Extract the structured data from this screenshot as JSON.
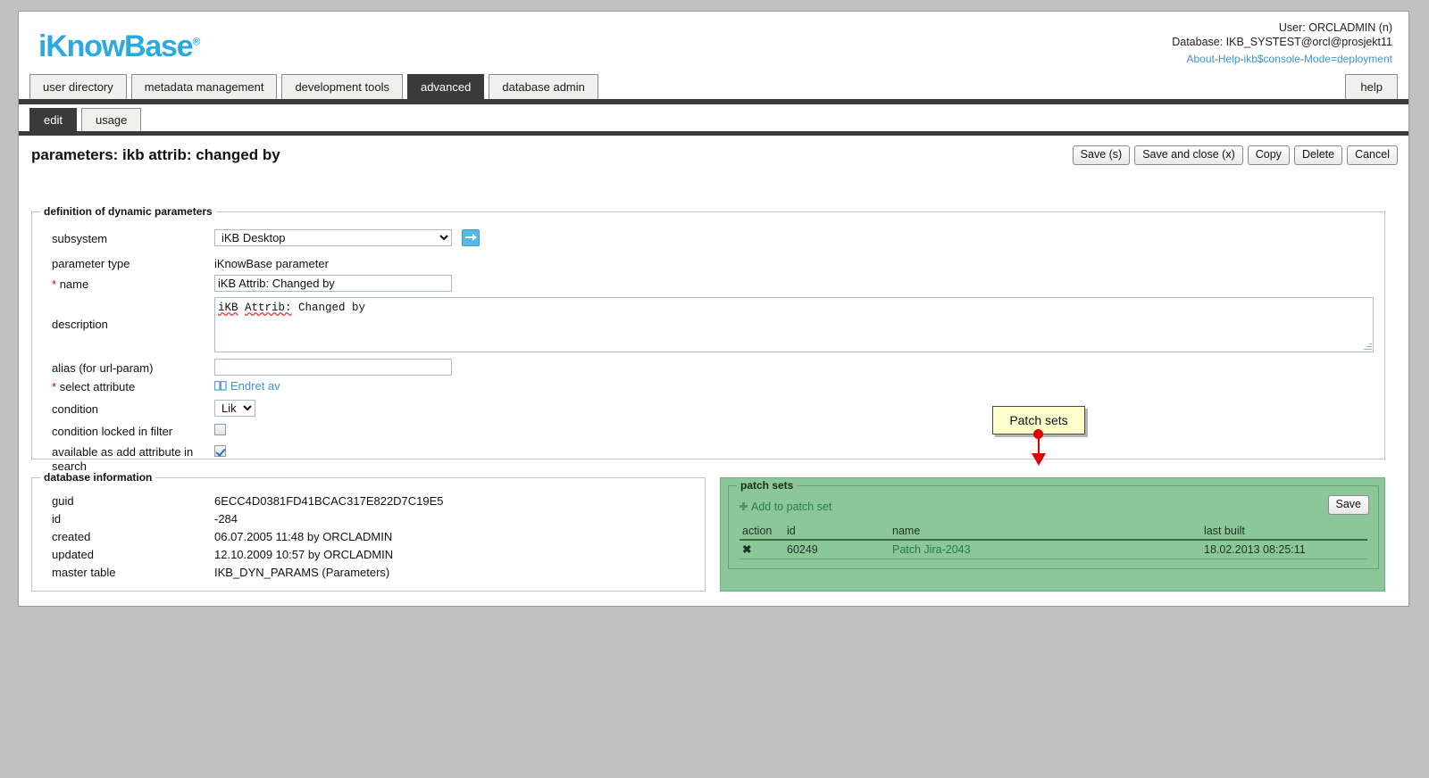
{
  "header": {
    "logo_text": "iKnowBase",
    "logo_reg": "®",
    "user_line": "User: ORCLADMIN (n)",
    "database_line": "Database: IKB_SYSTEST@orcl@prosjekt11",
    "links": [
      "About",
      "Help",
      "ikb$console",
      "Mode=deployment"
    ],
    "link_separator": "-"
  },
  "main_tabs": [
    {
      "label": "user directory",
      "active": false
    },
    {
      "label": "metadata management",
      "active": false
    },
    {
      "label": "development tools",
      "active": false
    },
    {
      "label": "advanced",
      "active": true
    },
    {
      "label": "database admin",
      "active": false
    }
  ],
  "help_tab": "help",
  "sub_tabs": [
    {
      "label": "edit",
      "active": true
    },
    {
      "label": "usage",
      "active": false
    }
  ],
  "page": {
    "title": "parameters: ikb attrib: changed by",
    "buttons": [
      "Save (s)",
      "Save and close (x)",
      "Copy",
      "Delete",
      "Cancel"
    ]
  },
  "definition": {
    "legend": "definition of dynamic parameters",
    "subsystem_label": "subsystem",
    "subsystem_value": "iKB Desktop",
    "subsystem_go_icon": "arrow-right-icon",
    "parameter_type_label": "parameter type",
    "parameter_type_value": "iKnowBase parameter",
    "name_label": "name",
    "name_value": "iKB Attrib: Changed by",
    "description_label": "description",
    "description_value": "iKB Attrib: Changed by",
    "description_spell_words": [
      "iKB",
      "Attrib:"
    ],
    "description_rest": " Changed by",
    "alias_label": "alias (for url-param)",
    "alias_value": "",
    "select_attribute_label": "select attribute",
    "select_attribute_value": "Endret av",
    "select_attribute_icon": "book-icon",
    "condition_label": "condition",
    "condition_value": "Lik",
    "condition_locked_label": "condition locked in filter",
    "condition_locked_checked": false,
    "available_add_label_line1": "available as add attribute in",
    "available_add_label_line2": "search",
    "available_add_checked": true,
    "required_marker": "*"
  },
  "database_info": {
    "legend": "database information",
    "rows": [
      {
        "label": "guid",
        "value": "6ECC4D0381FD41BCAC317E822D7C19E5"
      },
      {
        "label": "id",
        "value": "-284"
      },
      {
        "label": "created",
        "value": "06.07.2005 11:48 by ORCLADMIN"
      },
      {
        "label": "updated",
        "value": "12.10.2009 10:57 by ORCLADMIN"
      },
      {
        "label": "master table",
        "value": "IKB_DYN_PARAMS (Parameters)"
      }
    ]
  },
  "patch_sets": {
    "legend": "patch sets",
    "add_link": "Add to patch set",
    "add_icon": "plus-icon",
    "save_label": "Save",
    "columns": [
      "action",
      "id",
      "name",
      "last built"
    ],
    "rows": [
      {
        "action_icon": "delete-x-icon",
        "action": "✖",
        "id": "60249",
        "name": "Patch Jira-2043",
        "last_built": "18.02.2013 08:25:11"
      }
    ]
  },
  "annotation": {
    "callout_label": "Patch sets",
    "callout_color": "#ffffcc",
    "pointer_color": "#e00000"
  }
}
